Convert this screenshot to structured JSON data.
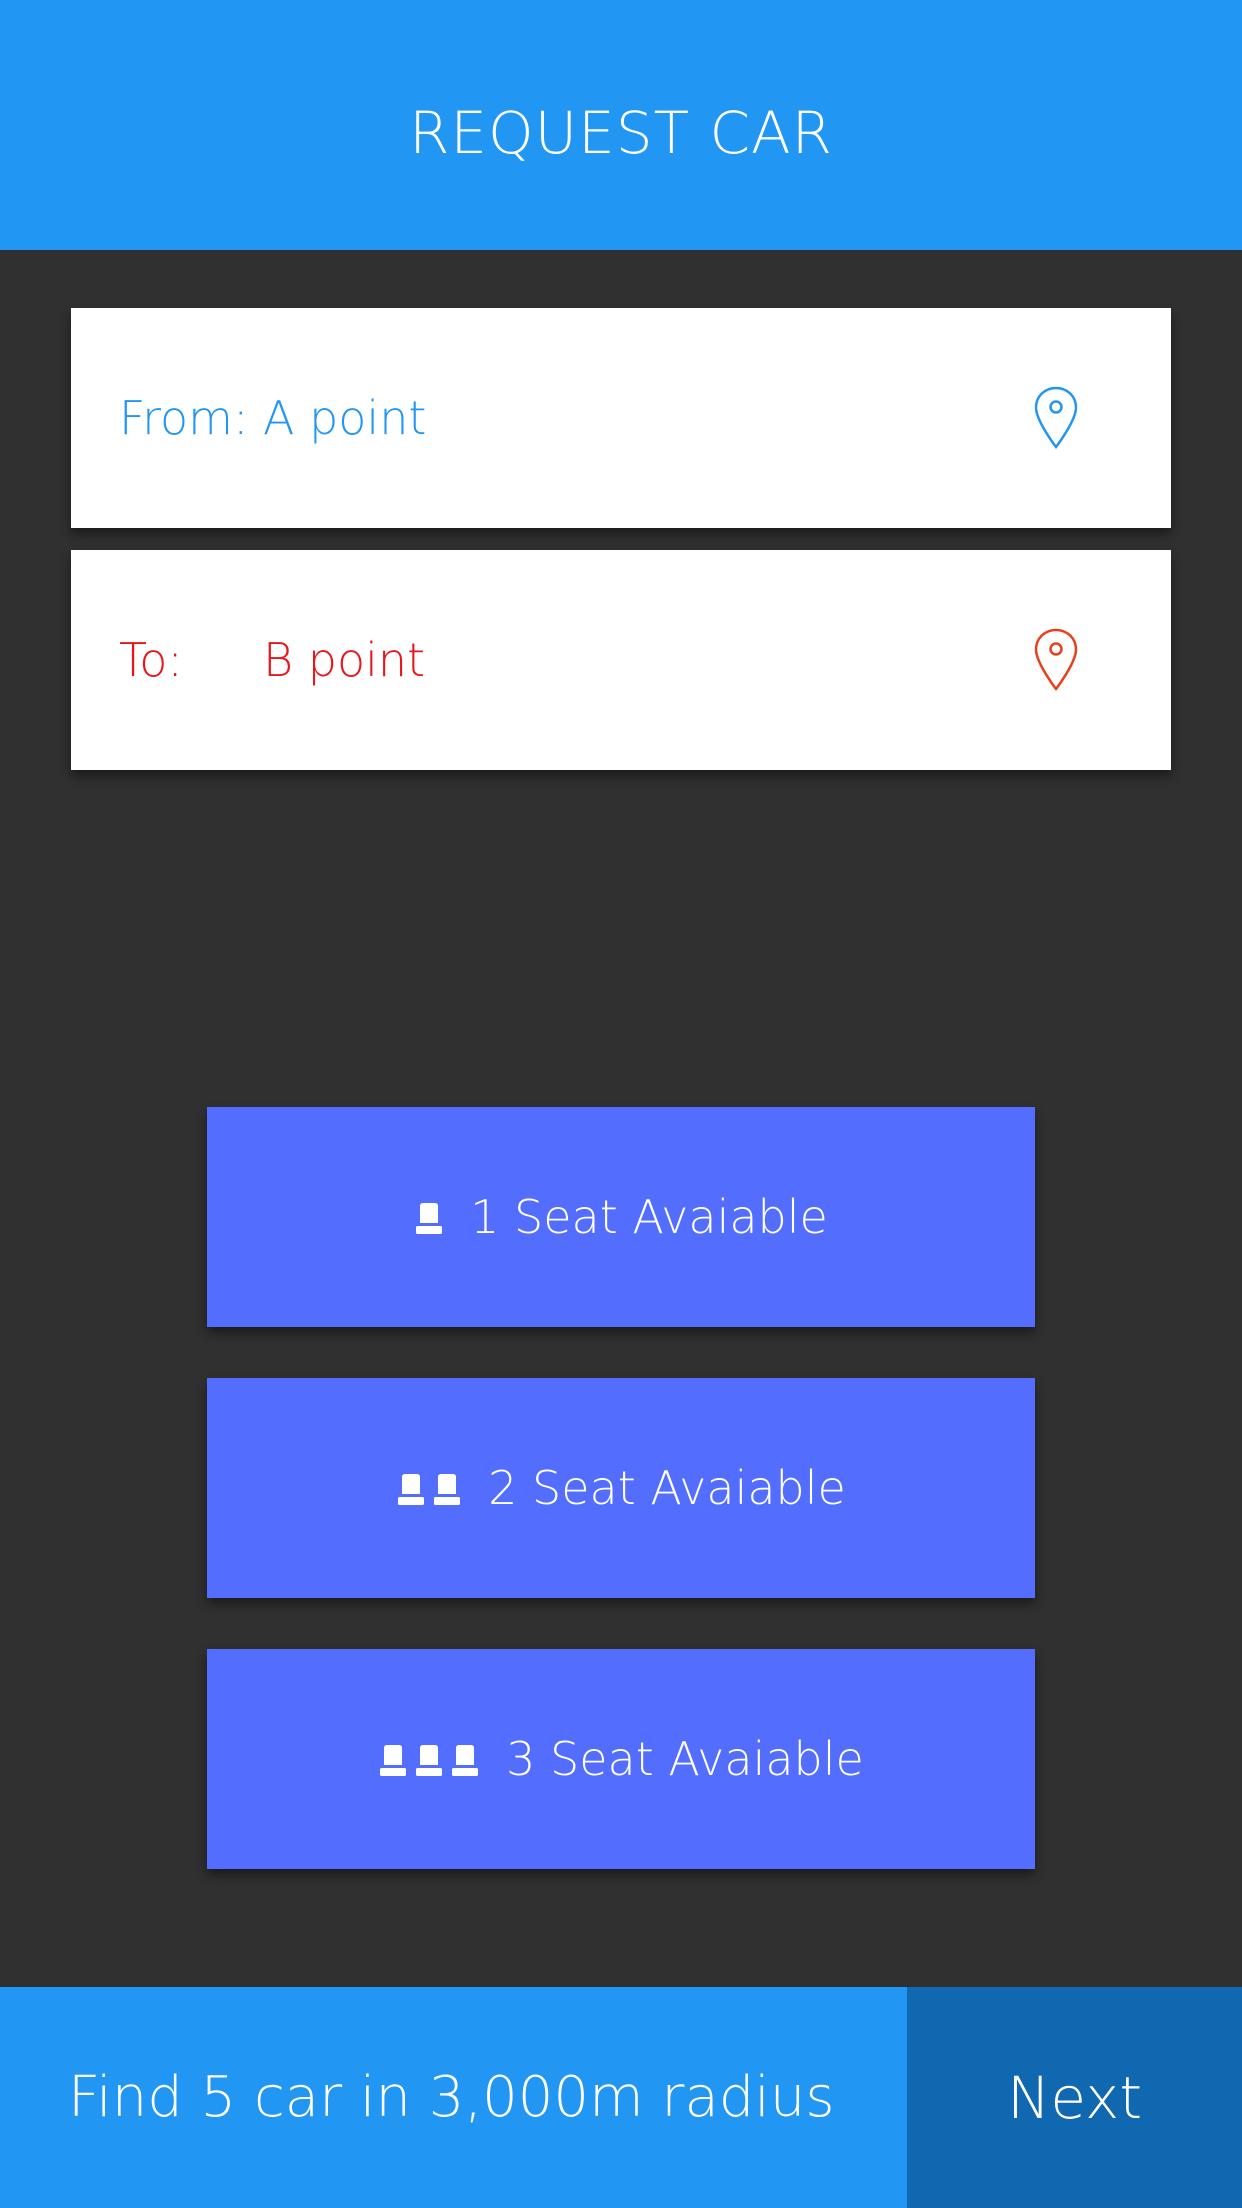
{
  "header": {
    "title": "REQUEST CAR"
  },
  "from": {
    "label": "From:",
    "value": "A point",
    "icon": "map-pin-icon",
    "color": "#2196F3"
  },
  "to": {
    "label": "To:",
    "value": "B point",
    "icon": "map-pin-icon",
    "color": "#E8161A"
  },
  "seat_options": [
    {
      "label": "1 Seat Avaiable",
      "seats": 1,
      "icon": "car-seat-icon"
    },
    {
      "label": "2 Seat Avaiable",
      "seats": 2,
      "icon": "car-seat-icon"
    },
    {
      "label": "3 Seat Avaiable",
      "seats": 3,
      "icon": "car-seat-icon"
    }
  ],
  "footer": {
    "info": "Find 5 car in 3,000m radius",
    "next_label": "Next"
  },
  "colors": {
    "primary": "#2196F3",
    "primary_dark": "#0F68B0",
    "accent": "#536DFE",
    "background": "#303030",
    "destination": "#E8161A"
  }
}
